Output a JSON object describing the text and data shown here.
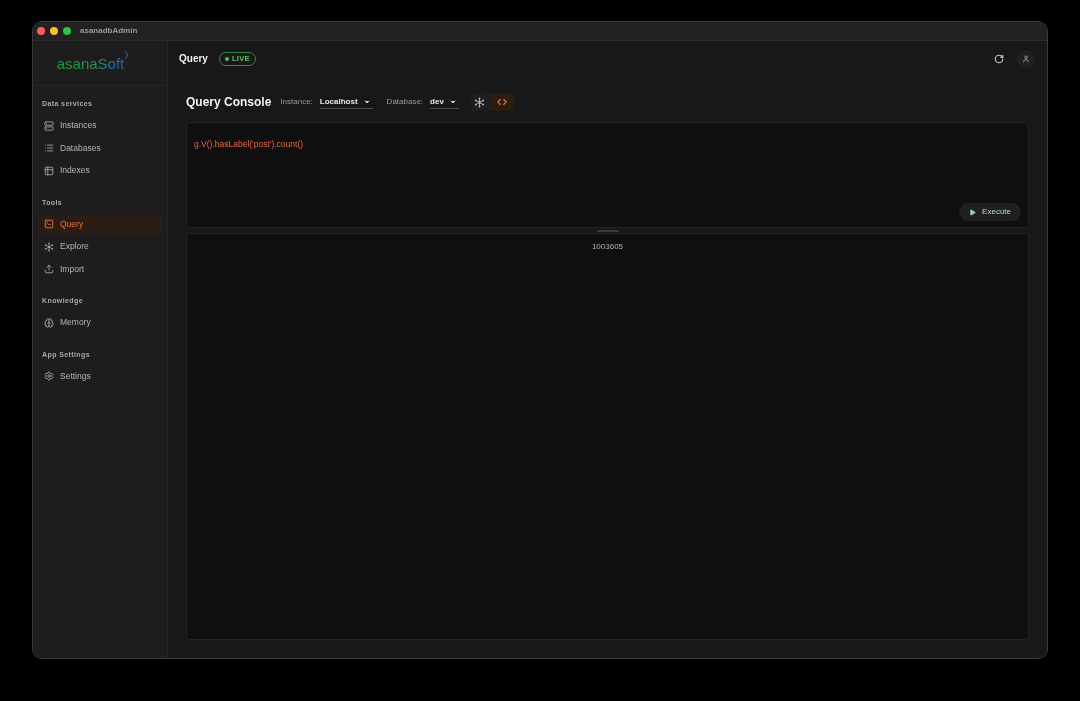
{
  "window": {
    "title": "asanadbAdmin"
  },
  "sidebar": {
    "logo": "asanaSoft",
    "sections": [
      {
        "heading": "Data services",
        "items": [
          {
            "label": "Instances",
            "selected": false
          },
          {
            "label": "Databases",
            "selected": false
          },
          {
            "label": "Indexes",
            "selected": false
          }
        ]
      },
      {
        "heading": "Tools",
        "items": [
          {
            "label": "Query",
            "selected": true
          },
          {
            "label": "Explore",
            "selected": false
          },
          {
            "label": "Import",
            "selected": false
          }
        ]
      },
      {
        "heading": "Knowledge",
        "items": [
          {
            "label": "Memory",
            "selected": false
          }
        ]
      },
      {
        "heading": "App Settings",
        "items": [
          {
            "label": "Settings",
            "selected": false
          }
        ]
      }
    ]
  },
  "header": {
    "title": "Query",
    "status_badge": "LIVE"
  },
  "console": {
    "title": "Query Console",
    "instance": {
      "label": "Instance:",
      "value": "Localhost"
    },
    "database": {
      "label": "Database:",
      "value": "dev"
    },
    "view_modes": [
      {
        "kind": "graph",
        "selected": false
      },
      {
        "kind": "code",
        "selected": true
      }
    ],
    "editor": {
      "value": "g.V().hasLabel('post').count()"
    },
    "execute_button": "Execute",
    "result": "1003605"
  }
}
